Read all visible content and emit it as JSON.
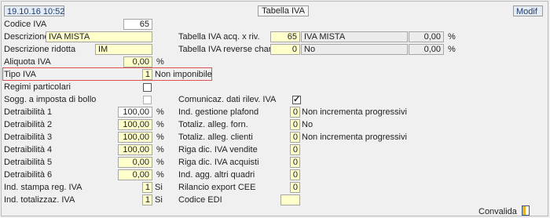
{
  "header": {
    "datetime": "19.10.16 10:52",
    "title": "Tabella IVA",
    "mode": "Modif"
  },
  "left": {
    "codice_iva": {
      "label": "Codice IVA",
      "value": "65"
    },
    "descrizione": {
      "label": "Descrizione",
      "value": "IVA MISTA"
    },
    "descrizione_ridotta": {
      "label": "Descrizione ridotta",
      "value": "IM"
    },
    "aliquota": {
      "label": "Aliquota IVA",
      "value": "0,00",
      "unit": "%"
    },
    "tipo_iva": {
      "label": "Tipo  IVA",
      "value": "1",
      "text": "Non imponibile"
    },
    "regimi": {
      "label": "Regimi particolari"
    },
    "soggetto_bollo": {
      "label": "Sogg. a imposta di bollo"
    },
    "detraibilita": [
      {
        "label": "Detraibilità  1",
        "value": "100,00",
        "unit": "%"
      },
      {
        "label": "Detraibilità  2",
        "value": "100,00",
        "unit": "%"
      },
      {
        "label": "Detraibilità  3",
        "value": "100,00",
        "unit": "%"
      },
      {
        "label": "Detraibilità  4",
        "value": "100,00",
        "unit": "%"
      },
      {
        "label": "Detraibilità  5",
        "value": "0,00",
        "unit": "%"
      },
      {
        "label": "Detraibilità  6",
        "value": "0,00",
        "unit": "%"
      }
    ],
    "ind_stampa": {
      "label": "Ind. stampa reg. IVA",
      "value": "1",
      "text": "Si"
    },
    "ind_totalizz": {
      "label": "Ind. totalizzaz. IVA",
      "value": "1",
      "text": "Si"
    }
  },
  "right": {
    "acq_riv": {
      "label": "Tabella IVA acq. x riv.",
      "code": "65",
      "desc": "IVA MISTA",
      "pct": "0,00",
      "unit": "%"
    },
    "reverse": {
      "label": "Tabella IVA reverse charge",
      "code": "0",
      "desc": "No",
      "pct": "0,00",
      "unit": "%"
    },
    "comunicaz": {
      "label": "Comunicaz. dati rilev. IVA",
      "check": "✓"
    },
    "ind_gestione": {
      "label": "Ind. gestione plafond",
      "value": "0",
      "text": "Non incrementa progressivi"
    },
    "totaliz_forn": {
      "label": "Totaliz. alleg. forn.",
      "value": "0",
      "text": "No"
    },
    "totaliz_clienti": {
      "label": "Totaliz. alleg. clienti",
      "value": "0",
      "text": "Non incrementa progressivi"
    },
    "riga_vendite": {
      "label": "Riga dic. IVA vendite",
      "value": "0"
    },
    "riga_acquisti": {
      "label": "Riga dic. IVA acquisti",
      "value": "0"
    },
    "ind_agg": {
      "label": "Ind. agg. altri quadri",
      "value": "0"
    },
    "rilancio": {
      "label": "Rilancio export  CEE",
      "value": "0"
    },
    "codice_edi": {
      "label": "Codice EDI",
      "value": ""
    }
  },
  "footer": {
    "convalida_label": "Convalida",
    "icon": "door-exit-icon"
  }
}
